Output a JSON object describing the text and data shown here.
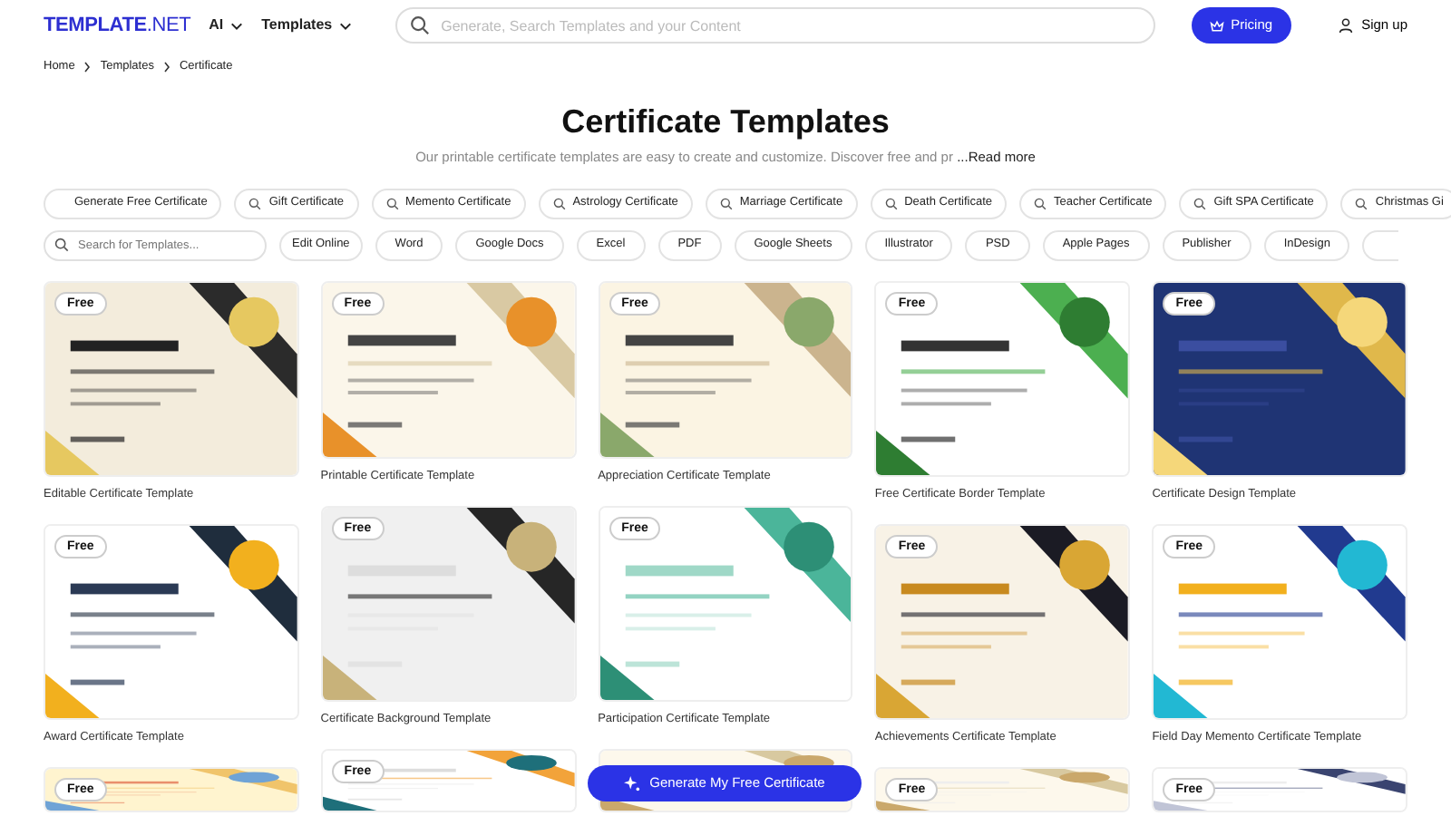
{
  "header": {
    "logo_main": "TEMPLATE",
    "logo_suffix": ".NET",
    "menus": [
      "AI",
      "Templates"
    ],
    "search": {
      "placeholder": "Generate, Search Templates and your Content"
    },
    "pricing": "Pricing",
    "sign_up": "Sign up"
  },
  "breadcrumbs": [
    "Home",
    "Templates",
    "Certificate"
  ],
  "title": "Certificate Templates",
  "description": "Our printable certificate templates are easy to create and customize. Discover free and pr",
  "read_more": "...Read more",
  "categories": [
    {
      "label": "Generate Free Certificate",
      "kind": "plain"
    },
    {
      "label": "Gift Certificate",
      "kind": "search"
    },
    {
      "label": "Memento Certificate",
      "kind": "search"
    },
    {
      "label": "Astrology Certificate",
      "kind": "search"
    },
    {
      "label": "Marriage Certificate",
      "kind": "search"
    },
    {
      "label": "Death Certificate",
      "kind": "search"
    },
    {
      "label": "Teacher Certificate",
      "kind": "search"
    },
    {
      "label": "Gift SPA Certificate",
      "kind": "search"
    },
    {
      "label": "Christmas Gi",
      "kind": "search"
    }
  ],
  "template_search": {
    "placeholder": "Search for Templates..."
  },
  "filters": [
    "Edit Online",
    "Word",
    "Google Docs",
    "Excel",
    "PDF",
    "Google Sheets",
    "Illustrator",
    "PSD",
    "Apple Pages",
    "Publisher",
    "InDesign"
  ],
  "columns": [
    [
      {
        "kind": "picture",
        "caption": "Editable Certificate Template",
        "badge": "Free"
      },
      {
        "kind": "picture",
        "caption": "Award Certificate Template",
        "badge": "Free"
      },
      {
        "kind": "picture",
        "badge": "Free"
      }
    ],
    [
      {
        "kind": "picture",
        "caption": "Printable Certificate Template",
        "badge": "Free"
      },
      {
        "kind": "picture",
        "caption": "Certificate Background Template",
        "badge": "Free"
      },
      {
        "kind": "picture",
        "badge": "Free"
      }
    ],
    [
      {
        "kind": "picture",
        "caption": "Appreciation Certificate Template",
        "badge": "Free"
      },
      {
        "kind": "picture",
        "caption": "Participation Certificate Template",
        "badge": "Free"
      },
      {
        "kind": "picture"
      }
    ],
    [
      {
        "kind": "picture",
        "caption": "Free Certificate Border Template",
        "badge": "Free"
      },
      {
        "kind": "picture",
        "caption": "Achievements Certificate Template",
        "badge": "Free"
      },
      {
        "kind": "picture",
        "badge": "Free"
      }
    ],
    [
      {
        "kind": "picture",
        "caption": "Certificate Design Template",
        "badge": "Free"
      },
      {
        "kind": "picture",
        "caption": "Field Day Memento Certificate Template",
        "badge": "Free"
      },
      {
        "kind": "picture",
        "badge": "Free"
      }
    ]
  ],
  "generate_button": "Generate My Free Certificate"
}
